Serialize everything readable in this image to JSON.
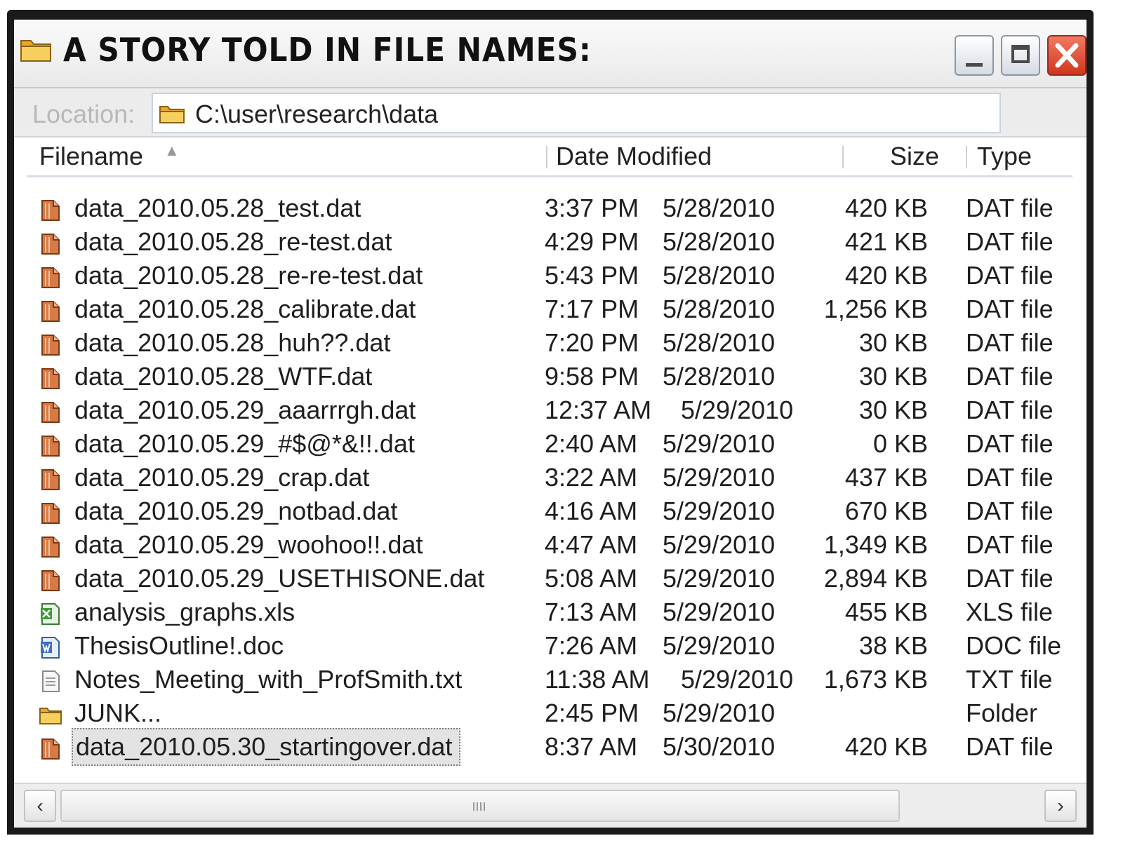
{
  "window": {
    "title": "A STORY TOLD IN FILE NAMES:",
    "location_label": "Location:",
    "location_path": "C:\\user\\research\\data"
  },
  "columns": {
    "filename": "Filename",
    "date_modified": "Date Modified",
    "size": "Size",
    "type": "Type"
  },
  "files": [
    {
      "name": "data_2010.05.28_test.dat",
      "time": "3:37 PM",
      "date": "5/28/2010",
      "size": "420 KB",
      "type": "DAT file",
      "icon": "dat-file-icon"
    },
    {
      "name": "data_2010.05.28_re-test.dat",
      "time": "4:29 PM",
      "date": "5/28/2010",
      "size": "421 KB",
      "type": "DAT file",
      "icon": "dat-file-icon"
    },
    {
      "name": "data_2010.05.28_re-re-test.dat",
      "time": "5:43 PM",
      "date": "5/28/2010",
      "size": "420 KB",
      "type": "DAT file",
      "icon": "dat-file-icon"
    },
    {
      "name": "data_2010.05.28_calibrate.dat",
      "time": "7:17 PM",
      "date": "5/28/2010",
      "size": "1,256 KB",
      "type": "DAT file",
      "icon": "dat-file-icon"
    },
    {
      "name": "data_2010.05.28_huh??.dat",
      "time": "7:20 PM",
      "date": "5/28/2010",
      "size": "30 KB",
      "type": "DAT file",
      "icon": "dat-file-icon"
    },
    {
      "name": "data_2010.05.28_WTF.dat",
      "time": "9:58 PM",
      "date": "5/28/2010",
      "size": "30 KB",
      "type": "DAT file",
      "icon": "dat-file-icon"
    },
    {
      "name": "data_2010.05.29_aaarrrgh.dat",
      "time": "12:37 AM",
      "date": "5/29/2010",
      "size": "30 KB",
      "type": "DAT file",
      "icon": "dat-file-icon"
    },
    {
      "name": "data_2010.05.29_#$@*&!!.dat",
      "time": "2:40 AM",
      "date": "5/29/2010",
      "size": "0 KB",
      "type": "DAT file",
      "icon": "dat-file-icon"
    },
    {
      "name": "data_2010.05.29_crap.dat",
      "time": "3:22 AM",
      "date": "5/29/2010",
      "size": "437 KB",
      "type": "DAT file",
      "icon": "dat-file-icon"
    },
    {
      "name": "data_2010.05.29_notbad.dat",
      "time": "4:16 AM",
      "date": "5/29/2010",
      "size": "670 KB",
      "type": "DAT file",
      "icon": "dat-file-icon"
    },
    {
      "name": "data_2010.05.29_woohoo!!.dat",
      "time": "4:47 AM",
      "date": "5/29/2010",
      "size": "1,349 KB",
      "type": "DAT file",
      "icon": "dat-file-icon"
    },
    {
      "name": "data_2010.05.29_USETHISONE.dat",
      "time": "5:08 AM",
      "date": "5/29/2010",
      "size": "2,894 KB",
      "type": "DAT file",
      "icon": "dat-file-icon"
    },
    {
      "name": "analysis_graphs.xls",
      "time": "7:13 AM",
      "date": "5/29/2010",
      "size": "455 KB",
      "type": "XLS file",
      "icon": "xls-file-icon"
    },
    {
      "name": "ThesisOutline!.doc",
      "time": "7:26 AM",
      "date": "5/29/2010",
      "size": "38 KB",
      "type": "DOC file",
      "icon": "doc-file-icon"
    },
    {
      "name": "Notes_Meeting_with_ProfSmith.txt",
      "time": "11:38 AM",
      "date": "5/29/2010",
      "size": "1,673 KB",
      "type": "TXT file",
      "icon": "txt-file-icon"
    },
    {
      "name": "JUNK...",
      "time": "2:45 PM",
      "date": "5/29/2010",
      "size": "",
      "type": "Folder",
      "icon": "folder-icon"
    },
    {
      "name": "data_2010.05.30_startingover.dat",
      "time": "8:37 AM",
      "date": "5/30/2010",
      "size": "420 KB",
      "type": "DAT file",
      "icon": "dat-file-icon",
      "selected": true
    }
  ],
  "colors": {
    "folder": "#f2c14e",
    "close_button": "#d9412a",
    "dat_icon": "#c8693a",
    "selection": "#e3e3e3"
  }
}
